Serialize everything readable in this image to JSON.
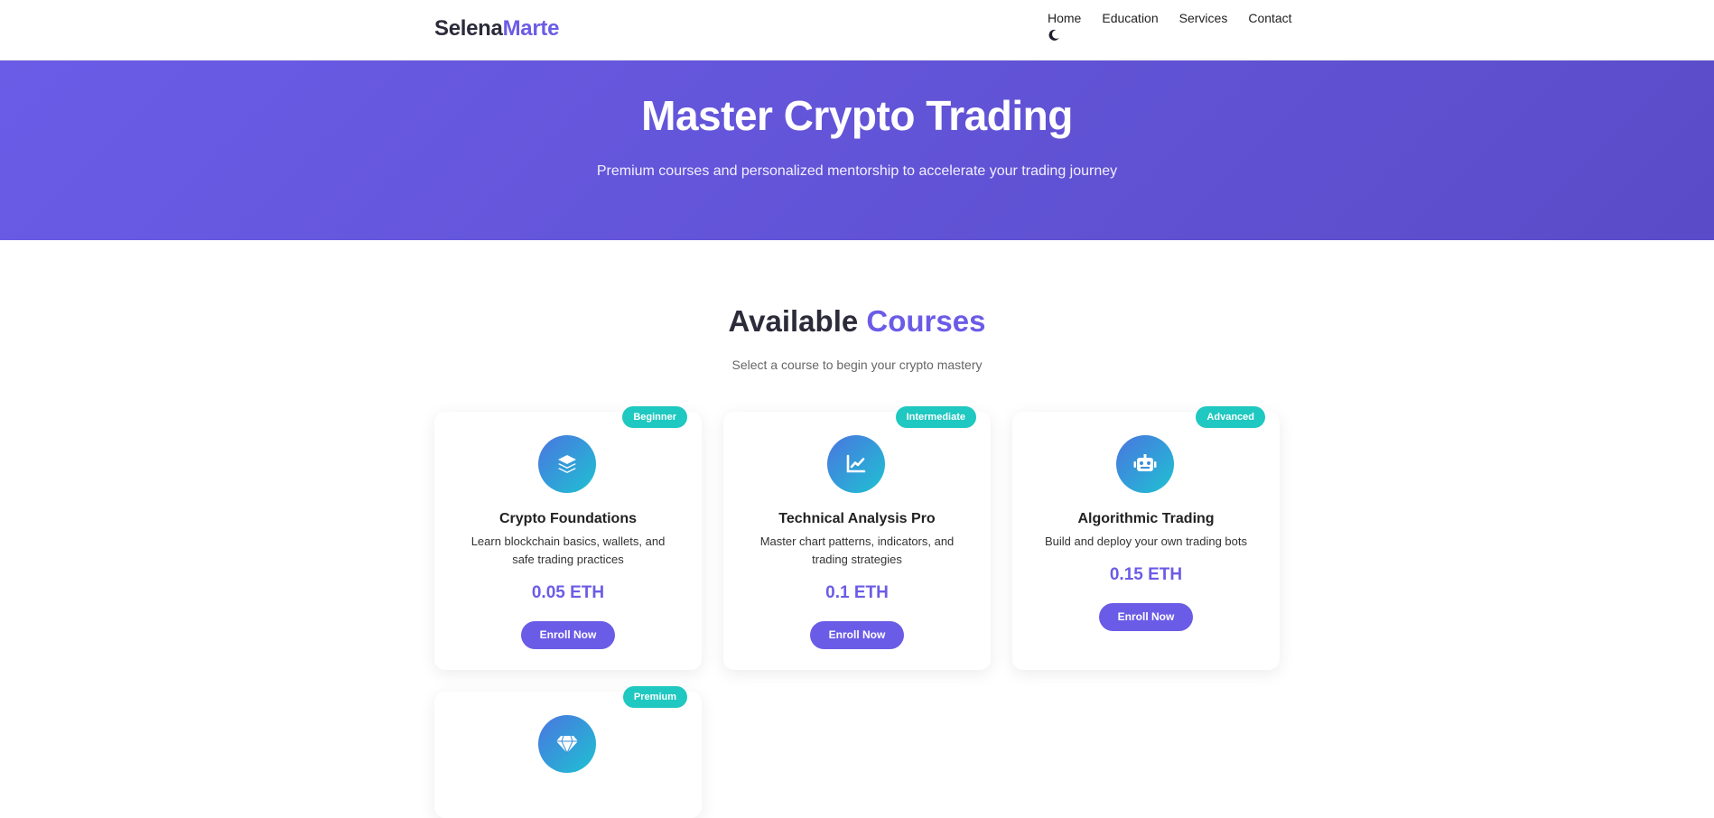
{
  "brand": {
    "first": "Selena",
    "second": "Marte"
  },
  "nav": {
    "items": [
      "Home",
      "Education",
      "Services",
      "Contact"
    ],
    "theme_icon": "moon-icon"
  },
  "hero": {
    "title": "Master Crypto Trading",
    "subtitle": "Premium courses and personalized mentorship to accelerate your trading journey"
  },
  "section": {
    "title_main": "Available ",
    "title_accent": "Courses",
    "subtitle": "Select a course to begin your crypto mastery"
  },
  "courses": [
    {
      "badge": "Beginner",
      "icon": "layers-icon",
      "title": "Crypto Foundations",
      "desc": "Learn blockchain basics, wallets, and safe trading practices",
      "price": "0.05 ETH",
      "cta": "Enroll Now"
    },
    {
      "badge": "Intermediate",
      "icon": "chart-line-icon",
      "title": "Technical Analysis Pro",
      "desc": "Master chart patterns, indicators, and trading strategies",
      "price": "0.1 ETH",
      "cta": "Enroll Now"
    },
    {
      "badge": "Advanced",
      "icon": "robot-icon",
      "title": "Algorithmic Trading",
      "desc": "Build and deploy your own trading bots",
      "price": "0.15 ETH",
      "cta": "Enroll Now"
    },
    {
      "badge": "Premium",
      "icon": "gem-icon"
    }
  ],
  "colors": {
    "accent": "#6b5ce7",
    "badge": "#1fc8c0",
    "icon_gradient_start": "#4a75e0",
    "icon_gradient_end": "#1ec2d2"
  }
}
